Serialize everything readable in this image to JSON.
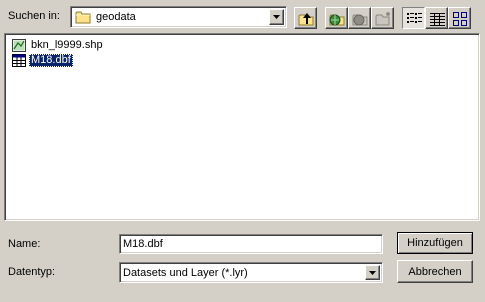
{
  "lookin": {
    "label": "Suchen in:",
    "value": "geodata"
  },
  "toolbar": {
    "up_icon": "up-folder-icon",
    "globe_icon": "connect-folder-icon",
    "disconnect_icon": "disconnect-folder-icon",
    "newfolder_icon": "new-folder-icon",
    "list_icon": "list-view-icon",
    "details_icon": "details-view-icon",
    "thumbnails_icon": "thumbnails-view-icon"
  },
  "files": [
    {
      "name": "bkn_l9999.shp",
      "icon": "shapefile-icon",
      "selected": false
    },
    {
      "name": "M18.dbf",
      "icon": "table-icon",
      "selected": true
    }
  ],
  "name_field": {
    "label": "Name:",
    "value": "M18.dbf"
  },
  "type_field": {
    "label": "Datentyp:",
    "value": "Datasets und Layer (*.lyr)"
  },
  "buttons": {
    "add": "Hinzufügen",
    "cancel": "Abbrechen"
  },
  "colors": {
    "dialog_bg": "#d4d0c8",
    "selection": "#0a246a"
  }
}
